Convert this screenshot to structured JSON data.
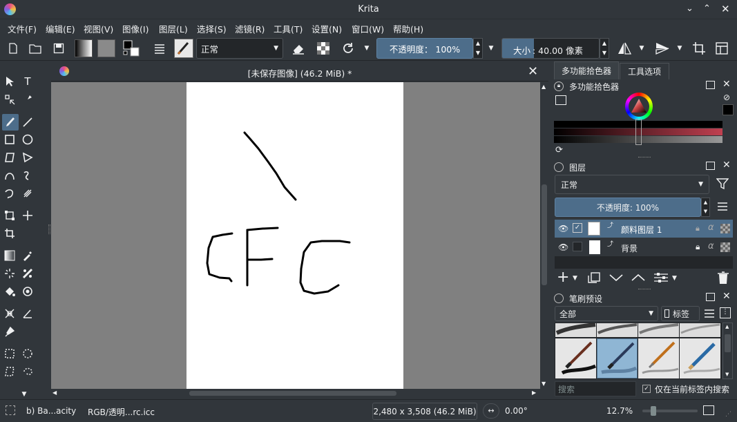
{
  "window": {
    "title": "Krita"
  },
  "menu": [
    "文件(F)",
    "编辑(E)",
    "视图(V)",
    "图像(I)",
    "图层(L)",
    "选择(S)",
    "滤镜(R)",
    "工具(T)",
    "设置(N)",
    "窗口(W)",
    "帮助(H)"
  ],
  "toolbar": {
    "blend_mode": "正常",
    "opacity": "不透明度： 100%",
    "size_label": "大小",
    "size_value": ": 40.00 像素"
  },
  "document": {
    "tab_title": "[未保存图像]  (46.2 MiB) *"
  },
  "dock_tabs": [
    "多功能拾色器",
    "工具选项"
  ],
  "color_selector": {
    "title": "多功能拾色器"
  },
  "layers": {
    "title": "图层",
    "blend_mode": "正常",
    "opacity": "不透明度:  100%",
    "items": [
      {
        "name": "颜料图层 1",
        "selected": true
      },
      {
        "name": "背景",
        "selected": false
      }
    ]
  },
  "brush_presets": {
    "title": "笔刷预设",
    "filter": "全部",
    "tag_label": "标签",
    "search_placeholder": "搜索",
    "search_in_tag_label": "仅在当前标签内搜索"
  },
  "status": {
    "brush": "b) Ba...acity",
    "color_profile": "RGB/透明...rc.icc",
    "dimensions": "2,480 x 3,508 (46.2 MiB)",
    "rotation": "0.00°",
    "zoom": "12.7%"
  },
  "colors": {
    "accent": "#4d6d8a",
    "bg": "#31363b",
    "canvas_bg": "#808080"
  }
}
